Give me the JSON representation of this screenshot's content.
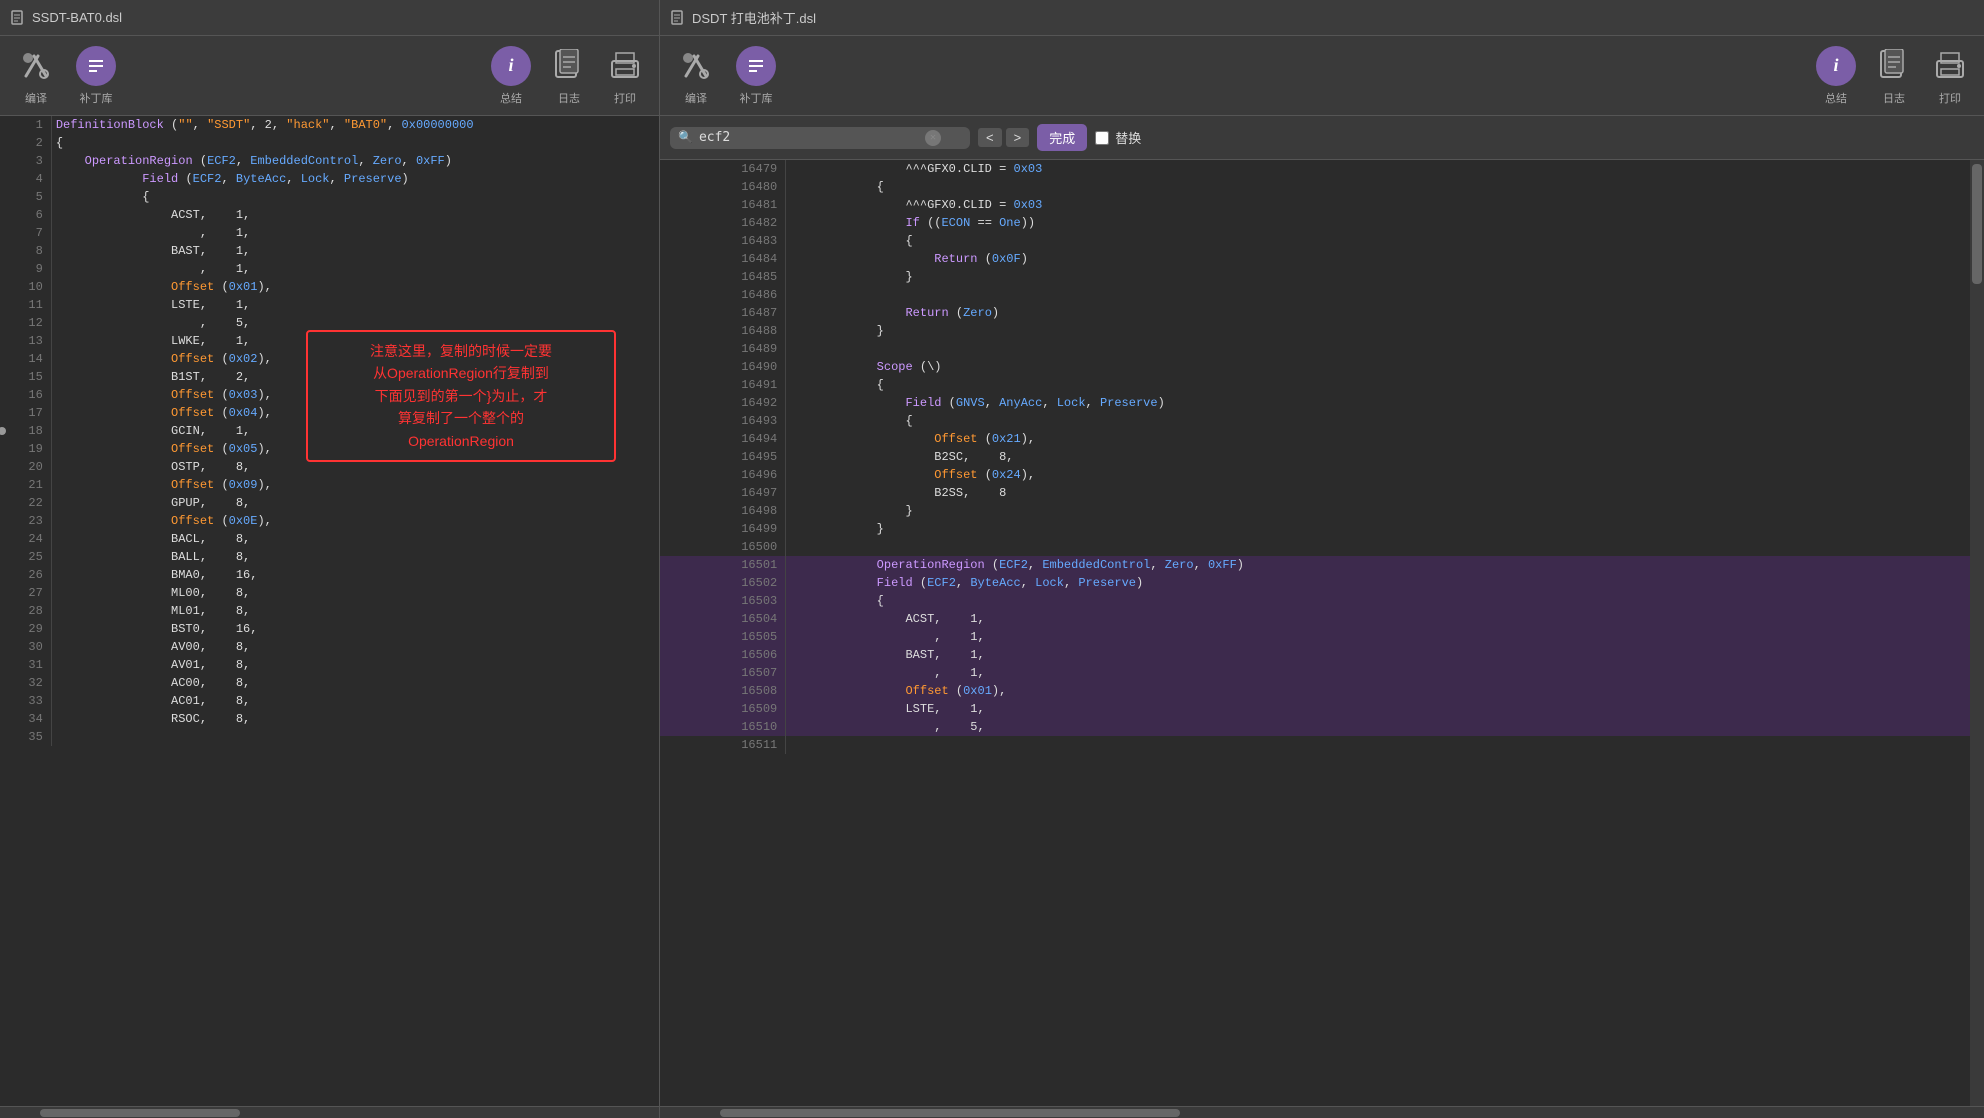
{
  "left": {
    "title": "SSDT-BAT0.dsl",
    "toolbar": {
      "compile_label": "编译",
      "patch_label": "补丁库",
      "summary_label": "总结",
      "log_label": "日志",
      "print_label": "打印"
    },
    "lines": [
      {
        "num": 1,
        "content": "DefinitionBlock (\"\", \"SSDT\", 2, \"hack\", \"BAT0\", 0x00000000"
      },
      {
        "num": 2,
        "content": "{"
      },
      {
        "num": 3,
        "content": "    OperationRegion (ECF2, EmbeddedControl, Zero, 0xFF)"
      },
      {
        "num": 4,
        "content": "            Field (ECF2, ByteAcc, Lock, Preserve)"
      },
      {
        "num": 5,
        "content": "            {"
      },
      {
        "num": 6,
        "content": "                ACST,    1,"
      },
      {
        "num": 7,
        "content": "                    ,    1,"
      },
      {
        "num": 8,
        "content": "                BAST,    1,"
      },
      {
        "num": 9,
        "content": "                    ,    1,"
      },
      {
        "num": 10,
        "content": "                Offset (0x01),"
      },
      {
        "num": 11,
        "content": "                LSTE,    1,"
      },
      {
        "num": 12,
        "content": "                    ,    5,"
      },
      {
        "num": 13,
        "content": "                LWKE,    1,"
      },
      {
        "num": 14,
        "content": "                Offset (0x02),"
      },
      {
        "num": 15,
        "content": "                B1ST,    2,"
      },
      {
        "num": 16,
        "content": "                Offset (0x03),"
      },
      {
        "num": 17,
        "content": "                Offset (0x04),"
      },
      {
        "num": 18,
        "content": "                GCIN,    1,"
      },
      {
        "num": 19,
        "content": "                Offset (0x05),"
      },
      {
        "num": 20,
        "content": "                OSTP,    8,"
      },
      {
        "num": 21,
        "content": "                Offset (0x09),"
      },
      {
        "num": 22,
        "content": "                GPUP,    8,"
      },
      {
        "num": 23,
        "content": "                Offset (0x0E),"
      },
      {
        "num": 24,
        "content": "                BACL,    8,"
      },
      {
        "num": 25,
        "content": "                BALL,    8,"
      },
      {
        "num": 26,
        "content": "                BMA0,    16,"
      },
      {
        "num": 27,
        "content": "                ML00,    8,"
      },
      {
        "num": 28,
        "content": "                ML01,    8,"
      },
      {
        "num": 29,
        "content": "                BST0,    16,"
      },
      {
        "num": 30,
        "content": "                AV00,    8,"
      },
      {
        "num": 31,
        "content": "                AV01,    8,"
      },
      {
        "num": 32,
        "content": "                AC00,    8,"
      },
      {
        "num": 33,
        "content": "                AC01,    8,"
      },
      {
        "num": 34,
        "content": "                RSOC,    8,"
      },
      {
        "num": 35,
        "content": ""
      }
    ],
    "annotation": {
      "line1": "注意这里，复制的时候一定要",
      "line2": "从OperationRegion行复制到",
      "line3": "下面见到的第一个}为止，才",
      "line4": "算复制了一个整个的",
      "line5": "OperationRegion"
    }
  },
  "right": {
    "title": "DSDT 打电池补丁.dsl",
    "toolbar": {
      "compile_label": "编译",
      "patch_label": "补丁库",
      "summary_label": "总结",
      "log_label": "日志",
      "print_label": "打印"
    },
    "search": {
      "value": "ecf2",
      "placeholder": "ecf2",
      "done_label": "完成",
      "replace_label": "替换"
    },
    "lines": [
      {
        "num": 16479,
        "content": "                ^^^GFX0.CLID = 0x03"
      },
      {
        "num": 16480,
        "content": "            {"
      },
      {
        "num": 16481,
        "content": "                ^^^GFX0.CLID = 0x03"
      },
      {
        "num": 16482,
        "content": "                If ((ECON == One))"
      },
      {
        "num": 16483,
        "content": "                {"
      },
      {
        "num": 16484,
        "content": "                    Return (0x0F)"
      },
      {
        "num": 16485,
        "content": "                }"
      },
      {
        "num": 16486,
        "content": ""
      },
      {
        "num": 16487,
        "content": "                Return (Zero)"
      },
      {
        "num": 16488,
        "content": "            }"
      },
      {
        "num": 16489,
        "content": ""
      },
      {
        "num": 16490,
        "content": "            Scope (\\)"
      },
      {
        "num": 16491,
        "content": "            {"
      },
      {
        "num": 16492,
        "content": "                Field (GNVS, AnyAcc, Lock, Preserve)"
      },
      {
        "num": 16493,
        "content": "                {"
      },
      {
        "num": 16494,
        "content": "                    Offset (0x21),"
      },
      {
        "num": 16495,
        "content": "                    B2SC,    8,"
      },
      {
        "num": 16496,
        "content": "                    Offset (0x24),"
      },
      {
        "num": 16497,
        "content": "                    B2SS,    8"
      },
      {
        "num": 16498,
        "content": "                }"
      },
      {
        "num": 16499,
        "content": "            }"
      },
      {
        "num": 16500,
        "content": ""
      },
      {
        "num": 16501,
        "content": "            OperationRegion (ECF2, EmbeddedControl, Zero, 0xFF)",
        "highlight": true
      },
      {
        "num": 16502,
        "content": "            Field (ECF2, ByteAcc, Lock, Preserve)",
        "highlight": true
      },
      {
        "num": 16503,
        "content": "            {",
        "highlight": true
      },
      {
        "num": 16504,
        "content": "                ACST,    1,",
        "highlight": true
      },
      {
        "num": 16505,
        "content": "                    ,    1,",
        "highlight": true
      },
      {
        "num": 16506,
        "content": "                BAST,    1,",
        "highlight": true
      },
      {
        "num": 16507,
        "content": "                    ,    1,",
        "highlight": true
      },
      {
        "num": 16508,
        "content": "                Offset (0x01),",
        "highlight": true
      },
      {
        "num": 16509,
        "content": "                LSTE,    1,",
        "highlight": true
      },
      {
        "num": 16510,
        "content": "                    ,    5,",
        "highlight": true
      },
      {
        "num": 16511,
        "content": ""
      }
    ]
  }
}
